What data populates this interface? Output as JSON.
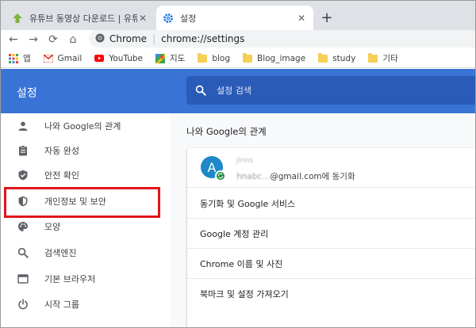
{
  "tabs": [
    {
      "title": "유튜브 동영상 다운로드 | 유튜브",
      "close": "✕"
    },
    {
      "title": "설정",
      "close": "✕"
    }
  ],
  "new_tab": "+",
  "toolbar": {
    "back": "←",
    "forward": "→",
    "reload": "⟳",
    "home": "⌂"
  },
  "omnibox": {
    "site_label": "Chrome",
    "separator": "|",
    "url": "chrome://settings"
  },
  "bookmarks": [
    {
      "label": "앱",
      "icon": "apps-icon"
    },
    {
      "label": "Gmail",
      "icon": "gmail-icon"
    },
    {
      "label": "YouTube",
      "icon": "youtube-icon"
    },
    {
      "label": "지도",
      "icon": "maps-icon"
    },
    {
      "label": "blog",
      "icon": "folder-icon"
    },
    {
      "label": "Blog_image",
      "icon": "folder-icon"
    },
    {
      "label": "study",
      "icon": "folder-icon"
    },
    {
      "label": "기타",
      "icon": "folder-icon"
    }
  ],
  "header": {
    "title": "설정",
    "search_placeholder": "설정 검색",
    "color": "#3a73d6"
  },
  "sidebar": {
    "items": [
      {
        "label": "나와 Google의 관계",
        "icon": "person-icon"
      },
      {
        "label": "자동 완성",
        "icon": "clipboard-icon"
      },
      {
        "label": "안전 확인",
        "icon": "shield-check-icon"
      },
      {
        "label": "개인정보 및 보안",
        "icon": "shield-icon",
        "highlighted": true
      },
      {
        "label": "모양",
        "icon": "palette-icon"
      },
      {
        "label": "검색엔진",
        "icon": "search-icon"
      },
      {
        "label": "기본 브라우저",
        "icon": "browser-icon"
      },
      {
        "label": "시작 그룹",
        "icon": "power-icon"
      }
    ]
  },
  "main": {
    "section_title": "나와 Google의 관계",
    "account": {
      "avatar_letter": "A",
      "name": "jinns",
      "email_prefix": "hnabc...",
      "email_suffix": "@gmail.com에 동기화"
    },
    "rows": [
      "동기화 및 Google 서비스",
      "Google 계정 관리",
      "Chrome 이름 및 사진",
      "북마크 및 설정 가져오기"
    ]
  },
  "colors": {
    "highlight": "#e0141c",
    "accent": "#3a73d6",
    "tab_strip": "#dee1e6"
  }
}
